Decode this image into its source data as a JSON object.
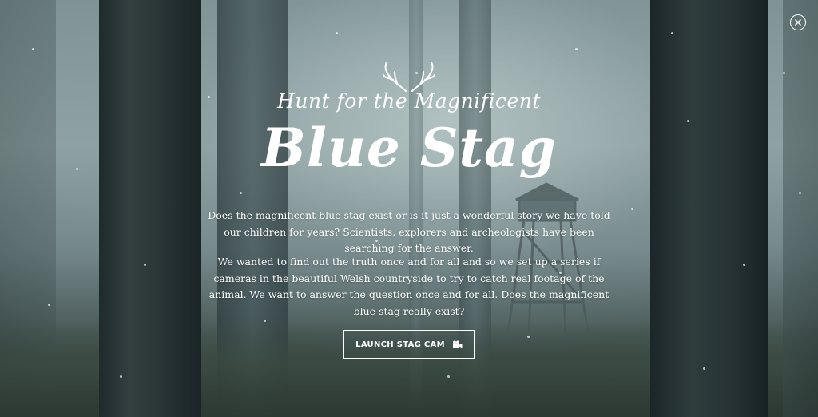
{
  "close": {
    "icon": "close-icon"
  },
  "hero": {
    "subtitle": "Hunt for the Magnificent",
    "title": "Blue Stag",
    "paragraph_1": "Does the magnificent blue stag exist or is it just a wonderful story we have told our children for years? Scientists, explorers and archeologists have been searching for the answer.",
    "paragraph_2": "We wanted to find out the truth once and for all and so we set up a series if cameras in the beautiful Welsh countryside to try to catch real footage of the animal. We want to answer the question once and for all. Does the magnificent blue stag really exist?",
    "cta_label": "LAUNCH STAG CAM",
    "cta_icon": "video-camera-icon",
    "logo_icon": "antlers-icon"
  },
  "colors": {
    "text": "#ffffff",
    "fog": "#8fa2a3",
    "trunk": "#1e2a2c"
  }
}
